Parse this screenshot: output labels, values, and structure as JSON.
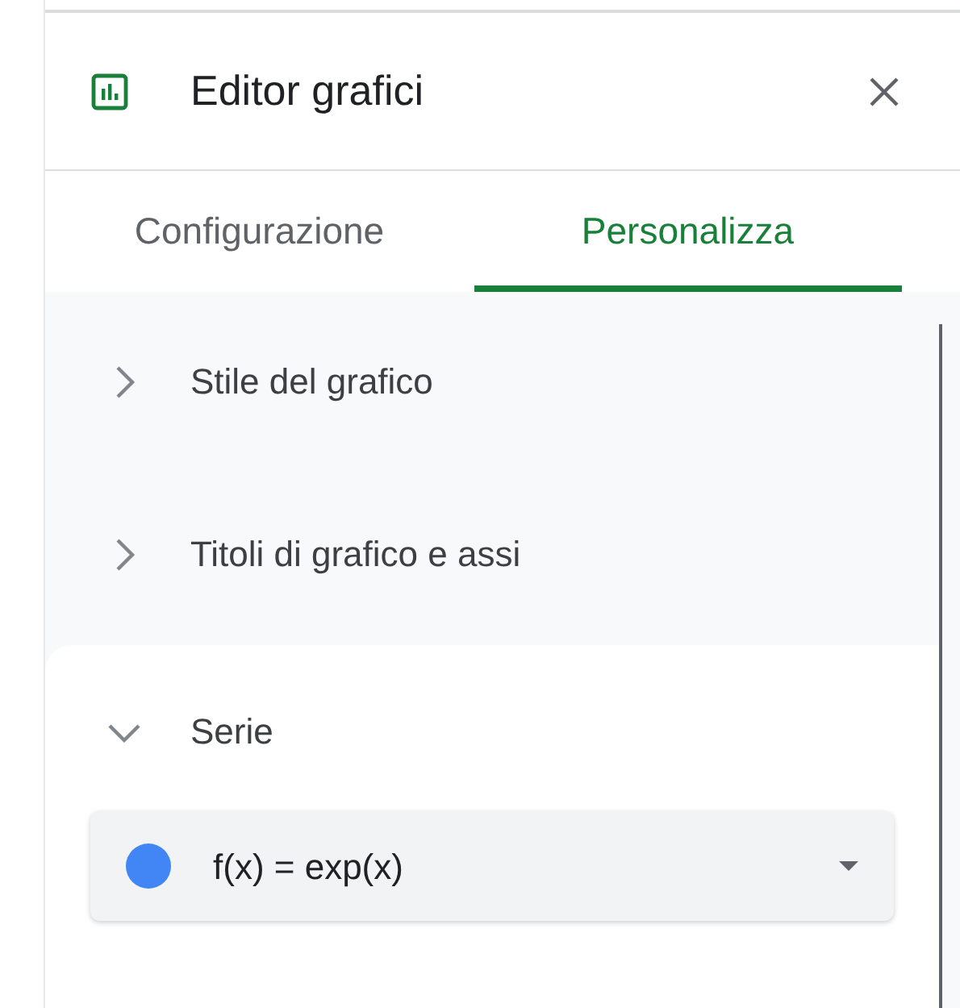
{
  "panel": {
    "title": "Editor grafici"
  },
  "tabs": [
    {
      "label": "Configurazione",
      "selected": false
    },
    {
      "label": "Personalizza",
      "selected": true
    }
  ],
  "sections": [
    {
      "label": "Stile del grafico",
      "expanded": false
    },
    {
      "label": "Titoli di grafico e assi",
      "expanded": false
    },
    {
      "label": "Serie",
      "expanded": true,
      "series_select": {
        "name": "f(x) = exp(x)",
        "color": "#4285f4"
      }
    }
  ]
}
